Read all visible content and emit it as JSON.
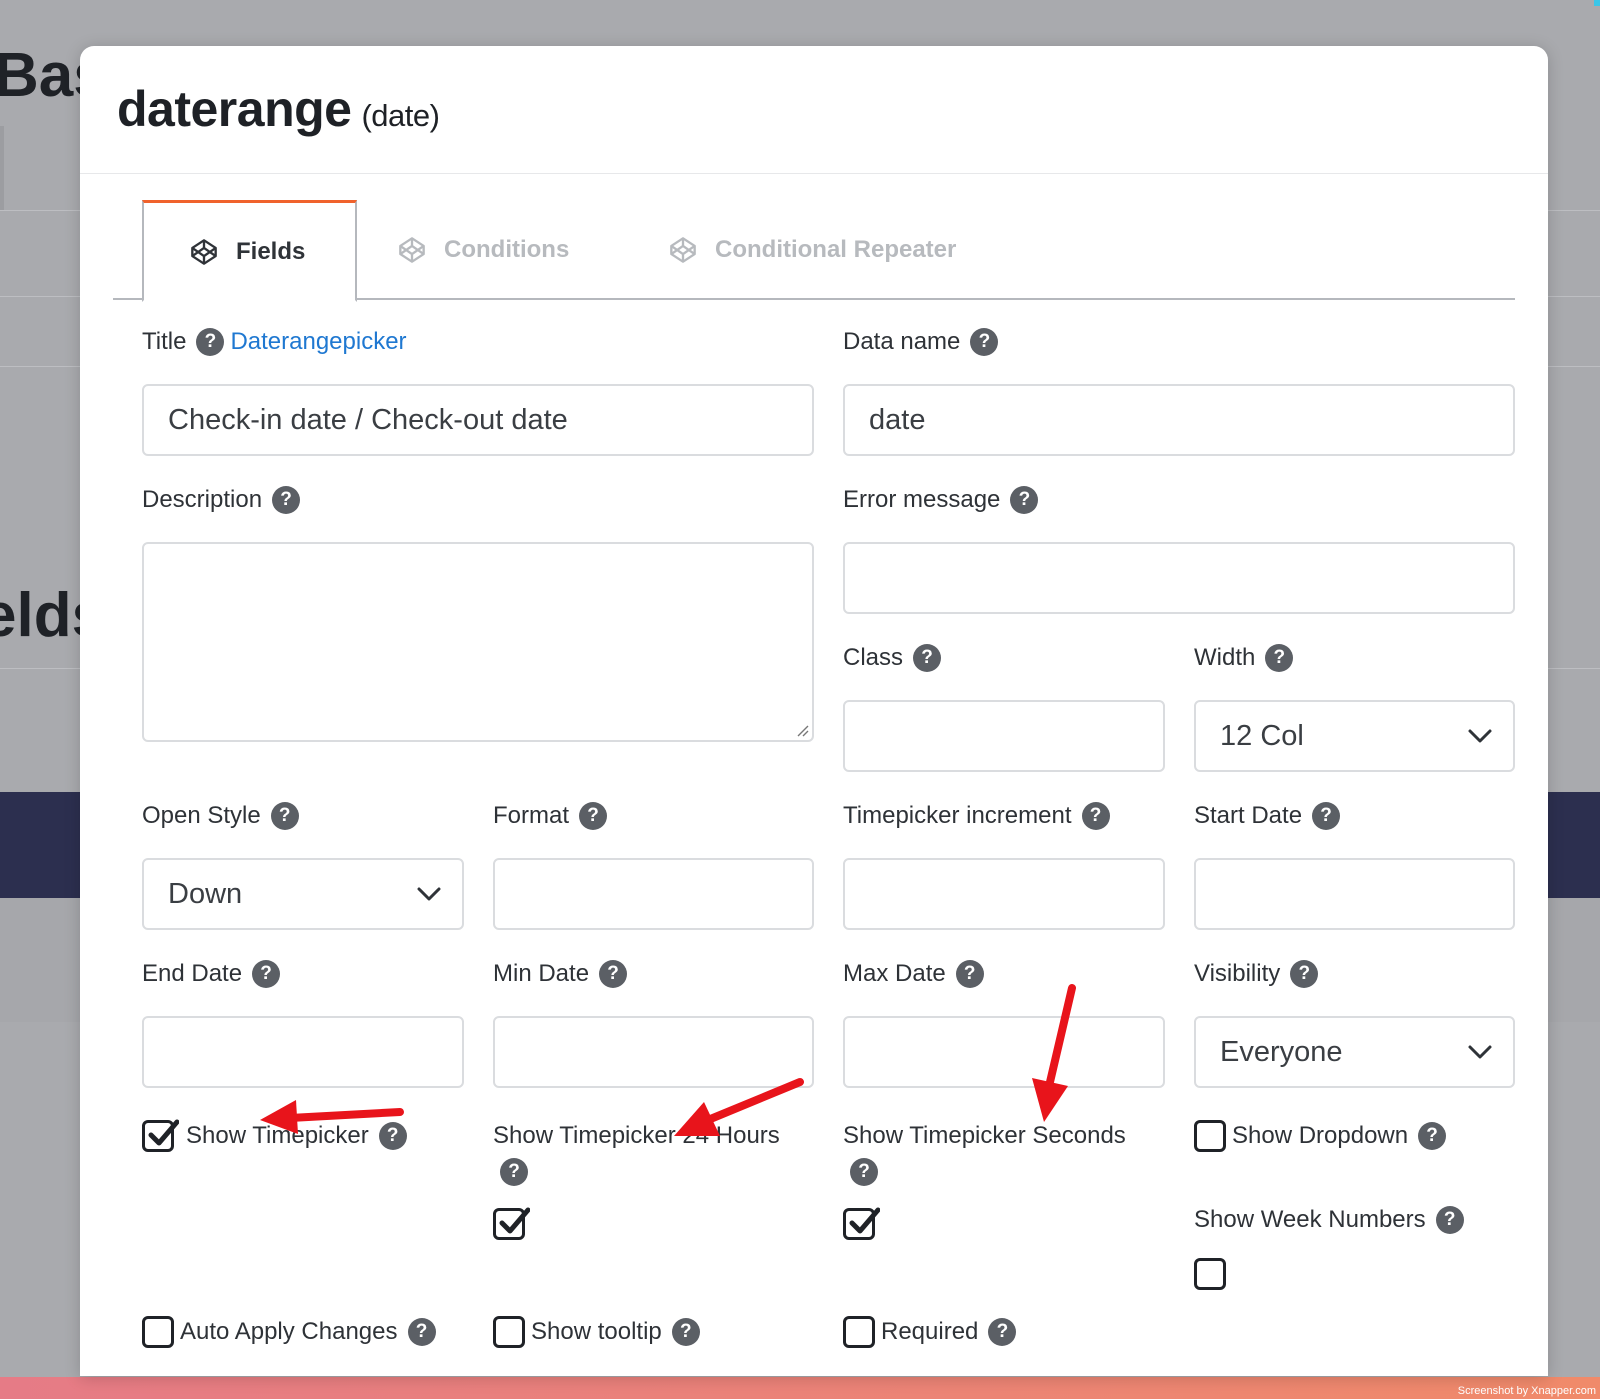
{
  "background": {
    "title_fragment": "Bas",
    "fields_fragment": "elds",
    "credit": "Screenshot by Xnapper.com"
  },
  "modal": {
    "title": "daterange",
    "subtitle": "(date)"
  },
  "tabs": [
    {
      "label": "Fields",
      "icon": "codepen-icon",
      "active": true
    },
    {
      "label": "Conditions",
      "icon": "codepen-icon",
      "active": false
    },
    {
      "label": "Conditional Repeater",
      "icon": "codepen-icon",
      "active": false
    }
  ],
  "form": {
    "title": {
      "label": "Title",
      "link": "Daterangepicker",
      "value": "Check-in date / Check-out date"
    },
    "data_name": {
      "label": "Data name",
      "value": "date"
    },
    "description": {
      "label": "Description",
      "value": ""
    },
    "error_message": {
      "label": "Error message",
      "value": ""
    },
    "class": {
      "label": "Class",
      "value": ""
    },
    "width": {
      "label": "Width",
      "value": "12 Col"
    },
    "open_style": {
      "label": "Open Style",
      "value": "Down"
    },
    "format": {
      "label": "Format",
      "value": ""
    },
    "timepicker_increment": {
      "label": "Timepicker increment",
      "value": ""
    },
    "start_date": {
      "label": "Start Date",
      "value": ""
    },
    "end_date": {
      "label": "End Date",
      "value": ""
    },
    "min_date": {
      "label": "Min Date",
      "value": ""
    },
    "max_date": {
      "label": "Max Date",
      "value": ""
    },
    "visibility": {
      "label": "Visibility",
      "value": "Everyone"
    }
  },
  "checkboxes": {
    "show_timepicker": {
      "label": "Show Timepicker",
      "checked": true
    },
    "show_timepicker_24": {
      "label": "Show Timepicker 24 Hours",
      "checked": true
    },
    "show_timepicker_seconds": {
      "label": "Show Timepicker Seconds",
      "checked": true
    },
    "show_dropdown": {
      "label": "Show Dropdown",
      "checked": false
    },
    "show_week_numbers": {
      "label": "Show Week Numbers",
      "checked": false
    },
    "auto_apply": {
      "label": "Auto Apply Changes",
      "checked": false
    },
    "show_tooltip": {
      "label": "Show tooltip",
      "checked": false
    },
    "required": {
      "label": "Required",
      "checked": false
    }
  },
  "help_glyph": "?",
  "colors": {
    "accent_tab": "#f0622c",
    "link": "#1f78d1",
    "annotation_arrow": "#e8141b"
  }
}
